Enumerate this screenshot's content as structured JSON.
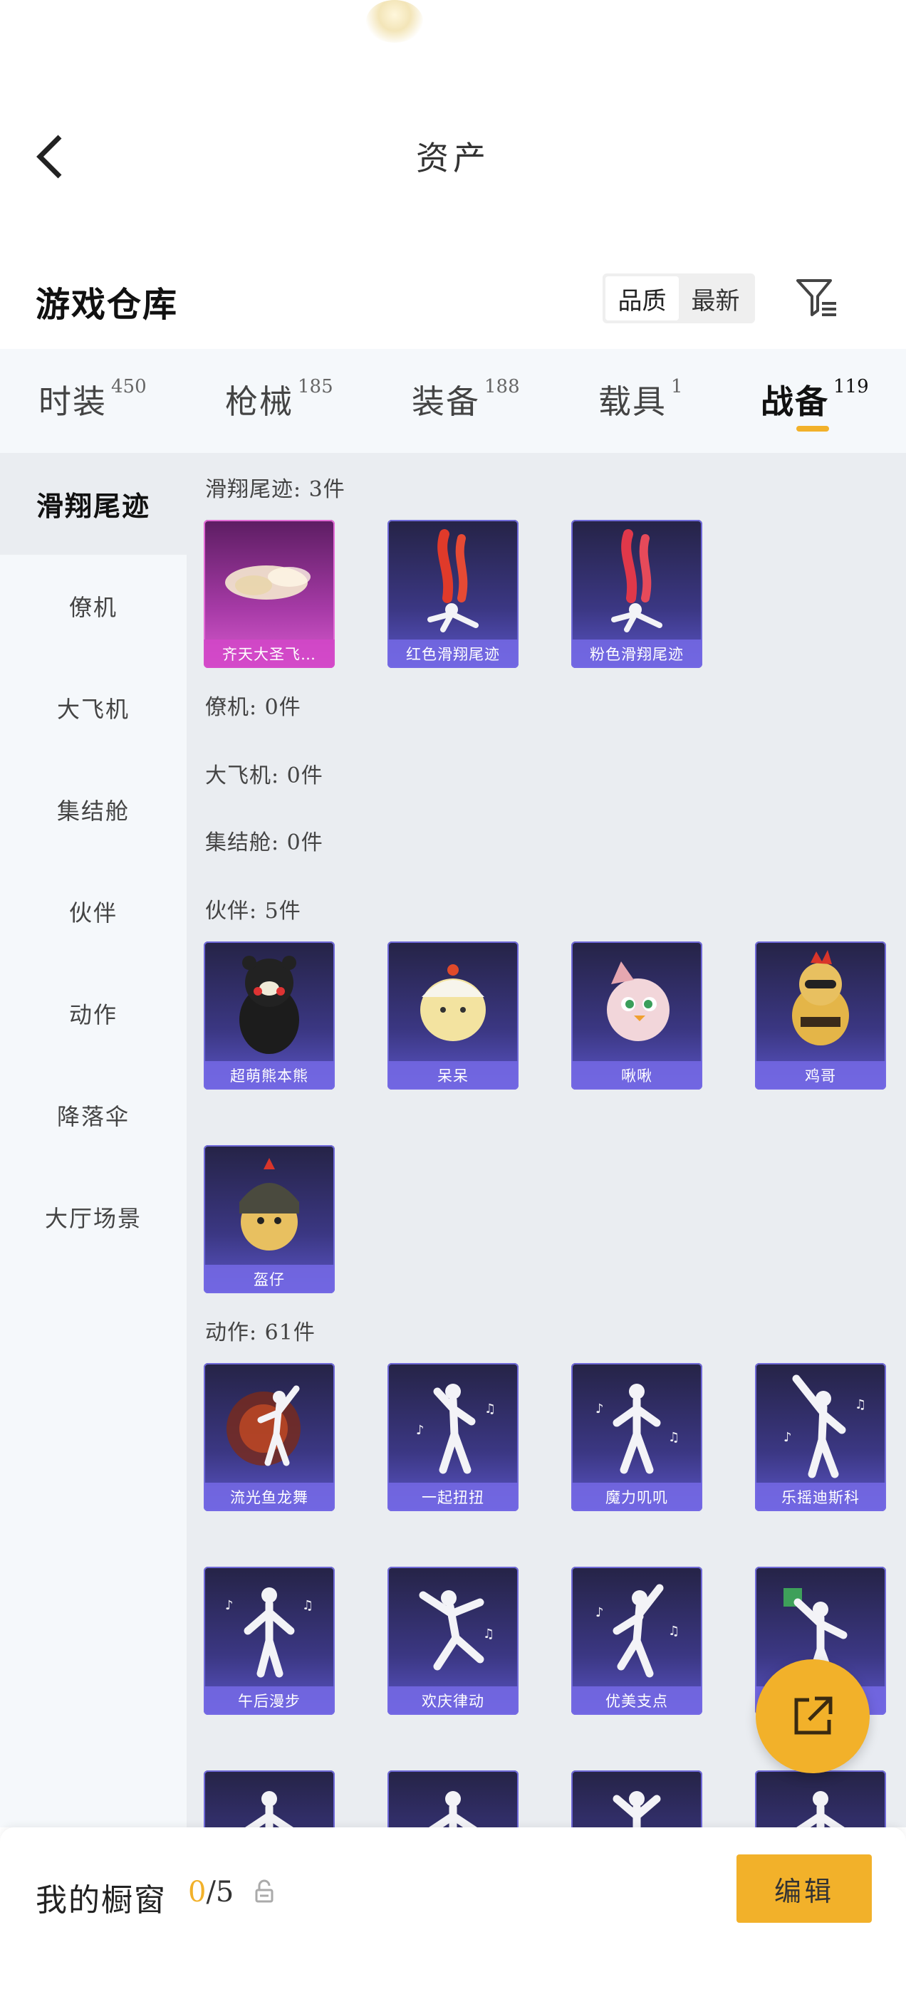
{
  "header": {
    "title": "资产"
  },
  "warehouse": {
    "title": "游戏仓库",
    "sort_options": [
      "品质",
      "最新"
    ],
    "active_sort": "品质"
  },
  "tabs": [
    {
      "label": "时装",
      "count": "450"
    },
    {
      "label": "枪械",
      "count": "185"
    },
    {
      "label": "装备",
      "count": "188"
    },
    {
      "label": "载具",
      "count": "1"
    },
    {
      "label": "战备",
      "count": "119"
    }
  ],
  "active_tab": "战备",
  "sidebar": {
    "items": [
      "滑翔尾迹",
      "僚机",
      "大飞机",
      "集结舱",
      "伙伴",
      "动作",
      "降落伞",
      "大厅场景"
    ],
    "active": "滑翔尾迹"
  },
  "sections": {
    "glide": {
      "title": "滑翔尾迹: 3件",
      "items": [
        "齐天大圣飞…",
        "红色滑翔尾迹",
        "粉色滑翔尾迹"
      ]
    },
    "wingman": {
      "title": "僚机: 0件"
    },
    "big_plane": {
      "title": "大飞机: 0件"
    },
    "pod": {
      "title": "集结舱: 0件"
    },
    "partner": {
      "title": "伙伴: 5件",
      "items": [
        "超萌熊本熊",
        "呆呆",
        "啾啾",
        "鸡哥",
        "盔仔"
      ]
    },
    "emote": {
      "title": "动作: 61件",
      "items": [
        "流光鱼龙舞",
        "一起扭扭",
        "魔力叽叽",
        "乐摇迪斯科",
        "午后漫步",
        "欢庆律动",
        "优美支点",
        ""
      ]
    }
  },
  "showcase": {
    "label": "我的橱窗",
    "current": "0",
    "total": "/5",
    "edit_label": "编辑"
  },
  "colors": {
    "accent": "#f2b12a",
    "card_purple": "#5c56c9",
    "card_pink": "#d95bcf"
  },
  "icons": {
    "back": "chevron-left-icon",
    "filter": "filter-list-icon",
    "share": "share-external-icon",
    "lock": "lock-icon"
  }
}
